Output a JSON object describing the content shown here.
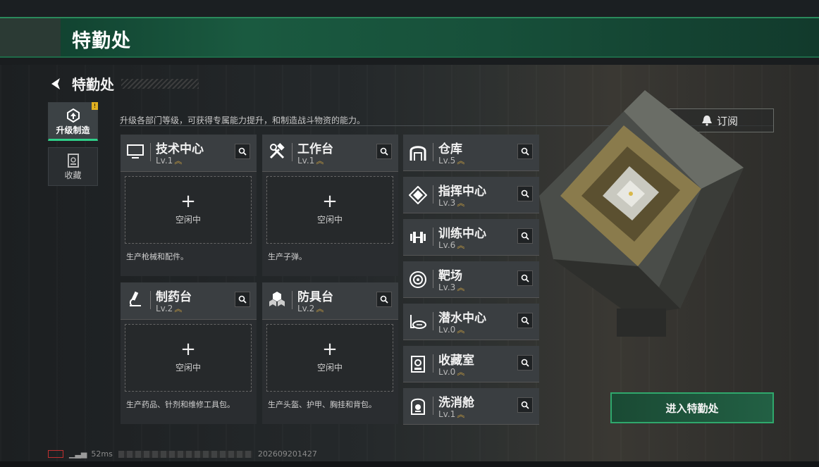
{
  "window": {
    "title": "特勤处"
  },
  "nav": {
    "back_label": "特勤处"
  },
  "sidebar": {
    "items": [
      {
        "label": "升级制造",
        "icon": "upgrade-icon",
        "badge": "!"
      },
      {
        "label": "收藏",
        "icon": "collection-icon"
      }
    ]
  },
  "description": "升级各部门等级，可获得专属能力提升，和制造战斗物资的能力。",
  "subscribe": {
    "label": "订阅",
    "icon": "bell-icon"
  },
  "workshops": [
    {
      "name": "技术中心",
      "level": "Lv.1",
      "icon": "monitor-icon",
      "slot_plus": "+",
      "slot_status": "空闲中",
      "note": "生产枪械和配件。"
    },
    {
      "name": "工作台",
      "level": "Lv.1",
      "icon": "tools-icon",
      "slot_plus": "+",
      "slot_status": "空闲中",
      "note": "生产子弹。"
    },
    {
      "name": "制药台",
      "level": "Lv.2",
      "icon": "microscope-icon",
      "slot_plus": "+",
      "slot_status": "空闲中",
      "note": "生产药品、针剂和维修工具包。"
    },
    {
      "name": "防具台",
      "level": "Lv.2",
      "icon": "armor-icon",
      "slot_plus": "+",
      "slot_status": "空闲中",
      "note": "生产头盔、护甲、胸挂和背包。"
    }
  ],
  "facilities": [
    {
      "name": "仓库",
      "level": "Lv.5",
      "icon": "warehouse-icon"
    },
    {
      "name": "指挥中心",
      "level": "Lv.3",
      "icon": "command-icon"
    },
    {
      "name": "训练中心",
      "level": "Lv.6",
      "icon": "dumbbell-icon"
    },
    {
      "name": "靶场",
      "level": "Lv.3",
      "icon": "target-icon"
    },
    {
      "name": "潜水中心",
      "level": "Lv.0",
      "icon": "diving-icon"
    },
    {
      "name": "收藏室",
      "level": "Lv.0",
      "icon": "vault-icon"
    },
    {
      "name": "洗消舱",
      "level": "Lv.1",
      "icon": "decon-icon"
    }
  ],
  "enter_button": {
    "label": "进入特勤处"
  },
  "status": {
    "ping": "52ms",
    "code": "202609201427"
  },
  "colors": {
    "accent": "#2fd089",
    "title_bg": "#1a5a40",
    "level_chevron": "#d4a640",
    "card_bg": "#3a3e41"
  }
}
